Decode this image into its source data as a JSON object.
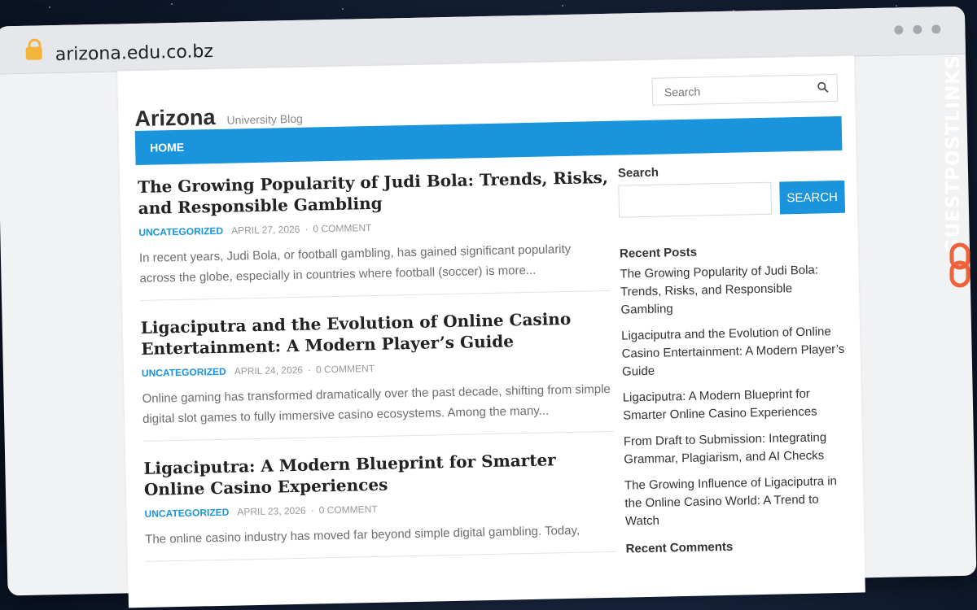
{
  "browser": {
    "url": "arizona.edu.co.bz"
  },
  "site": {
    "title": "Arizona",
    "tagline": "University Blog",
    "search_placeholder": "Search",
    "nav": [
      "HOME"
    ]
  },
  "posts": [
    {
      "title": "The Growing Popularity of Judi Bola: Trends, Risks, and Responsible Gambling",
      "category": "UNCATEGORIZED",
      "date": "APRIL 27, 2026",
      "comments": "0 COMMENT",
      "excerpt": "In recent years, Judi Bola, or football gambling, has gained significant popularity across the globe, especially in countries where football (soccer) is more..."
    },
    {
      "title": "Ligaciputra and the Evolution of Online Casino Entertainment: A Modern Player’s Guide",
      "category": "UNCATEGORIZED",
      "date": "APRIL 24, 2026",
      "comments": "0 COMMENT",
      "excerpt": "Online gaming has transformed dramatically over the past decade, shifting from simple digital slot games to fully immersive casino ecosystems. Among the many..."
    },
    {
      "title": "Ligaciputra: A Modern Blueprint for Smarter Online Casino Experiences",
      "category": "UNCATEGORIZED",
      "date": "APRIL 23, 2026",
      "comments": "0 COMMENT",
      "excerpt": "The online casino industry has moved far beyond simple digital gambling. Today,"
    }
  ],
  "sidebar": {
    "search_label": "Search",
    "search_button": "SEARCH",
    "recent_posts_title": "Recent Posts",
    "recent_posts": [
      "The Growing Popularity of Judi Bola: Trends, Risks, and Responsible Gambling",
      "Ligaciputra and the Evolution of Online Casino Entertainment: A Modern Player’s Guide",
      "Ligaciputra: A Modern Blueprint for Smarter Online Casino Experiences",
      "From Draft to Submission: Integrating Grammar, Plagiarism, and AI Checks",
      "The Growing Influence of Ligaciputra in the Online Casino World: A Trend to Watch"
    ],
    "recent_comments_title": "Recent Comments"
  },
  "watermark": {
    "text": "GUESTPOSTLINKS",
    "icon": "link-icon",
    "accent": "#f0623a"
  },
  "colors": {
    "accent": "#1a94dc"
  }
}
